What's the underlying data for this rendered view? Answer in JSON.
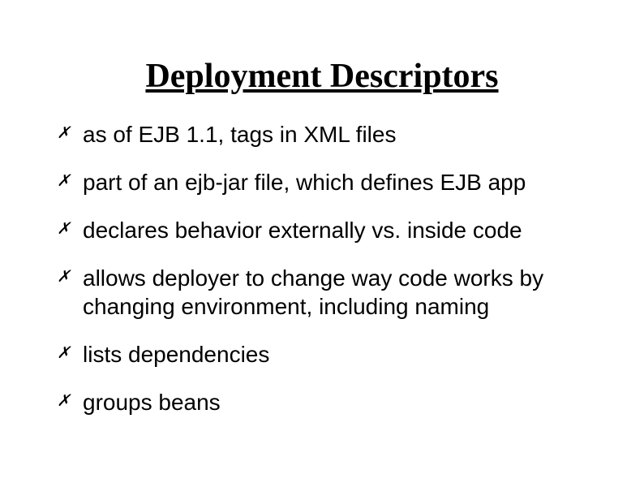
{
  "slide": {
    "title": "Deployment Descriptors",
    "bullet_marker": "✗",
    "bullets": [
      "as of EJB 1.1, tags in XML files",
      "part of an ejb-jar file, which defines EJB app",
      "declares behavior externally vs. inside code",
      "allows deployer to change way code works by changing environment, including naming",
      "lists dependencies",
      "groups beans"
    ]
  }
}
